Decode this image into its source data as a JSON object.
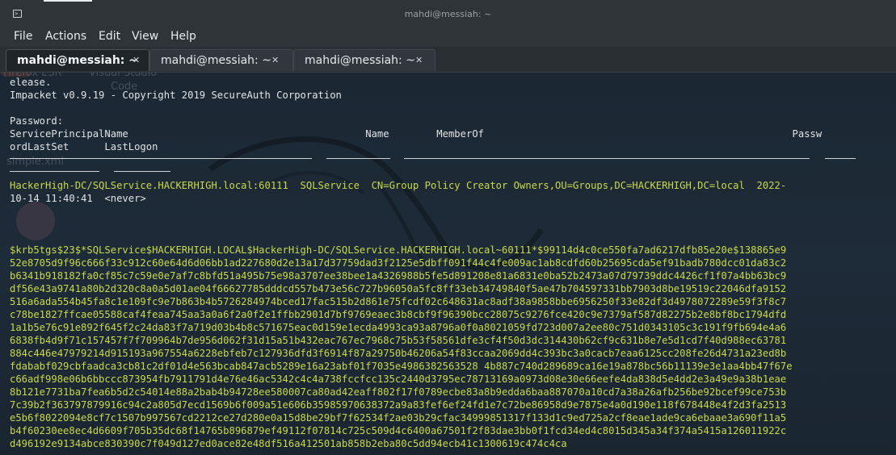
{
  "window": {
    "title": "mahdi@messiah: ~",
    "terminal_icon": "terminal-icon"
  },
  "menu": [
    "File",
    "Actions",
    "Edit",
    "View",
    "Help"
  ],
  "tabs": [
    {
      "label": "mahdi@messiah: ~",
      "active": true
    },
    {
      "label": "mahdi@messiah: ~",
      "active": false
    },
    {
      "label": "mahdi@messiah: ~",
      "active": false
    }
  ],
  "desktop_ghosts": {
    "firefox": "Firefox ESR",
    "vscode_1": "Visual Studio",
    "vscode_2": "Code",
    "file": "simple.xml"
  },
  "terminal": {
    "header_lines": [
      "elease.",
      "Impacket v0.9.19 - Copyright 2019 SecureAuth Corporation",
      "",
      "Password:"
    ],
    "columns_line_1": "ServicePrincipalName                                        Name        MemberOf                                                    Passw",
    "columns_line_2": "ordLastSet      LastLogon",
    "result_line_1": "HackerHigh-DC/SQLService.HACKERHIGH.local:60111  SQLService  CN=Group Policy Creator Owners,OU=Groups,DC=HACKERHIGH,DC=local  2022-",
    "result_line_2": "10-14 11:40:41  <never>",
    "hash_lines": [
      "$krb5tgs$23$*SQLService$HACKERHIGH.LOCAL$HackerHigh-DC/SQLService.HACKERHIGH.local~60111*$99114d4c0ce550fa7ad6217dfb85e20e$138865e9",
      "52e8705d9f96c666f33c912c60e64d6d06bb1ad227680d2e13a17d37759dad3f2125e5dbff091f44c4fe009ac1ab8cdfd60b25695cda5ef91badb780dcc01da83c2",
      "b6341b918182fa0cf85c7c59e0e7af7c8bfd51a495b75e98a3707ee38bee1a4326988b5fe5d891208e81a6831e0ba52b2473a07d79739ddc4426cf1f07a4bb63bc9",
      "df56e43a9741a80b2d320c8a0a5d01ae04f66627785dddcd557b473e56c727b96050a5fc8ff33eb34749840f5ae47b704597331bb7903d8be19519c22046dfa9152",
      "516a6ada554b45fa8c1e109fc9e7b863b4b5726284974bced17fac515b2d861e75fcdf02c648631ac8adf38a9858bbe6956250f33e82df3d4978072289e59f3f8c7",
      "c78be1827ffcae05588caf4feaa745aa3a0a6f2a0f2e1ffbb2901d7bf9769eaec3b8cbf9f96390bcc28075c9276fce420c9e7379af587d82275b2e8bf8bc1794dfd",
      "1a1b5e76c91e892f645f2c24da83f7a719d03b4b8c571675eac0d159e1ecda4993ca93a8796a0f0a8021059fd723d007a2ee80c751d0343105c3c191f9fb694e4a6",
      "6838fb4d9f71c157457f7f709964b7de956d062f31d15a51b432eac767ec7968c75b53f58561dfe3cf4f50d3dc314430b62cf9c631b8e7e5d1cd7f40d988ec63781",
      "884c446e47979214d915193a967554a6228ebfeb7c127936dfd3f6914f87a29750b46206a54f83ccaa2069dd4c393bc3a0cacb7eaa6125cc208fe26d4731a23ed8b",
      "fdababf029cbfaadca3cb81c2df01d4e563bcab847acb5289e16a23abf01f7035e4986382563528 4b887c740d289689ca16e19a878bc56b11139e3e1aa4bb47f67e",
      "c66adf998e06b6bbccc873954fb7911791d4e76e46ac5342c4c4a738fccfcc135c2440d3795ec78713169a0973d08e30e66eefe4da838d5e4dd2e3a49e9a38b1eae",
      "8b121e7731ba7fea6b5d2c54014e88a2bab4b94728ee580007ca80ad42eaff802f17f0789ecbe83a8b9edda6baa887070a10cd7a38a26afb256be92bcef99ce753b",
      "7c39b2f363797879916c94c2a805d7ecd1569b6f009a51e606b35985970638372a9a83fef6ef24fd1e7c72be86958d9e7875e4a0d190e118f678448e4f2d3fa2513",
      "e5b6f8022094e8cf7c1507b997567cd2212ce27d280e0a15d8be29bf7f62534f2ae03b29cfac34999851317f133d1c9ed725a2cf8eae1ade9ca6ebaae3a690f11a5",
      "b4f60230ee8ec4d6609f705b35dc68f14765b896879ef49112f07814c725c509d4c6400a67501f2f83dae3bb0f1fcd34ed4c8015d345a34f374a5415a126011922c",
      "d496192e9134abce830390c7f049d127ed0ace82e48df516a412501ab858b2eba80c5dd94ecb41c1300619c474c4ca"
    ]
  },
  "colors": {
    "window_chrome": "#2e3437",
    "terminal_bg": "#1b2834",
    "text": "#e0e3e6",
    "highlight_green": "#c8d94a"
  }
}
